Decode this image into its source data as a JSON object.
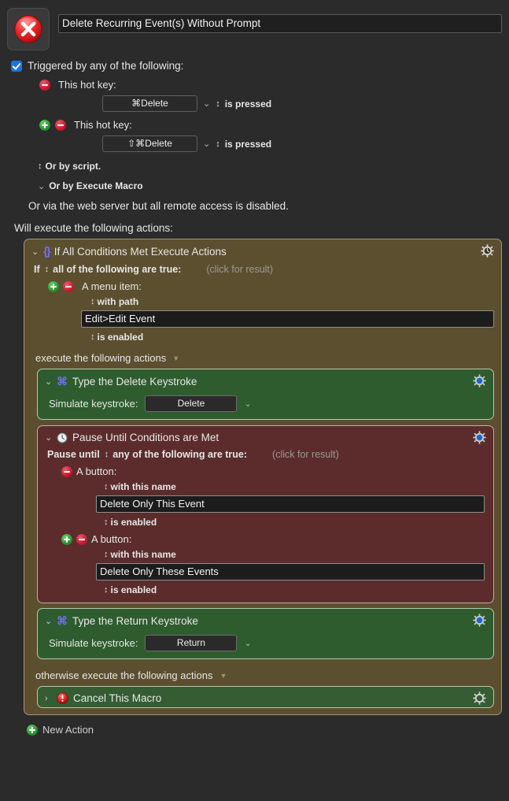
{
  "macro": {
    "icon": "red-x-circle-icon",
    "title": "Delete Recurring Event(s) Without Prompt"
  },
  "triggers": {
    "checkbox_checked": true,
    "heading": "Triggered by any of the following:",
    "items": [
      {
        "label": "This hot key:",
        "has_add": false,
        "has_remove": true,
        "key": "⌘Delete",
        "condition": "is pressed"
      },
      {
        "label": "This hot key:",
        "has_add": true,
        "has_remove": true,
        "key": "⇧⌘Delete",
        "condition": "is pressed"
      }
    ],
    "or_by_script": "Or by script.",
    "or_by_execute_macro": "Or by Execute Macro",
    "web_server_note": "Or via the web server but all remote access is disabled."
  },
  "actions_heading": "Will execute the following actions:",
  "if_action": {
    "title": "If All Conditions Met Execute Actions",
    "icon": "braces-icon",
    "gear_icon": "gear-clock-icon",
    "disclosure": "⌄",
    "if_label": "If",
    "match_mode": "all of the following are true:",
    "click_for_result": "(click for result)",
    "conditions": [
      {
        "type_label": "A menu item:",
        "has_add": true,
        "has_remove": true,
        "qualifier": "with path",
        "value": "Edit>Edit Event",
        "state": "is enabled"
      }
    ],
    "then_label": "execute the following actions",
    "otherwise_label": "otherwise execute the following actions"
  },
  "then_actions": [
    {
      "kind": "keystroke",
      "title": "Type the Delete Keystroke",
      "icon": "command-key-icon",
      "gear_icon": "gear-blue-icon",
      "disclosure": "⌄",
      "field_label": "Simulate keystroke:",
      "key": "Delete"
    },
    {
      "kind": "pause",
      "title": "Pause Until Conditions are Met",
      "icon": "clock-icon",
      "gear_icon": "gear-blue-icon",
      "disclosure": "⌄",
      "pause_label": "Pause until",
      "match_mode": "any of the following are true:",
      "click_for_result": "(click for result)",
      "conditions": [
        {
          "type_label": "A button:",
          "has_add": false,
          "has_remove": true,
          "qualifier": "with this name",
          "value": "Delete Only This Event",
          "state": "is enabled"
        },
        {
          "type_label": "A button:",
          "has_add": true,
          "has_remove": true,
          "qualifier": "with this name",
          "value": "Delete Only These Events",
          "state": "is enabled"
        }
      ]
    },
    {
      "kind": "keystroke",
      "title": "Type the Return Keystroke",
      "icon": "command-key-icon",
      "gear_icon": "gear-blue-icon",
      "disclosure": "⌄",
      "field_label": "Simulate keystroke:",
      "key": "Return"
    }
  ],
  "else_actions": [
    {
      "kind": "cancel",
      "title": "Cancel This Macro",
      "icon": "stop-exclamation-icon",
      "gear_icon": "gear-grey-icon",
      "disclosure": "›"
    }
  ],
  "footer": {
    "new_action": "New Action",
    "new_action_icon": "plus-circle-icon"
  },
  "colors": {
    "page_bg": "#2b2b2b",
    "if_block": "#5c4f2f",
    "green_block": "#2f5c2f",
    "cancel_block": "#355c33",
    "red_block": "#5c2c2c",
    "accent_blue": "#1a74e2",
    "icon_purple": "#6e6ef0",
    "add_green": "#1d8b25",
    "remove_red": "#c31227"
  }
}
